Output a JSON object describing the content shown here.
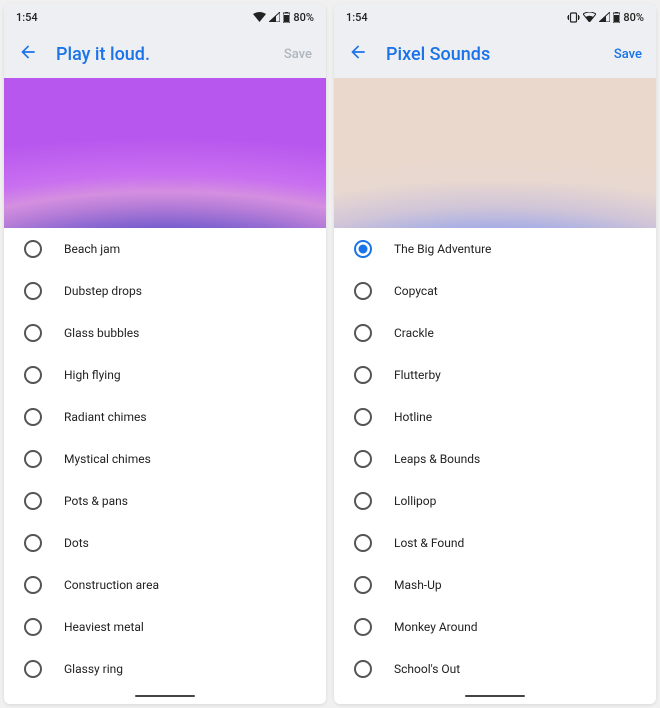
{
  "screens": [
    {
      "status": {
        "time": "1:54",
        "battery": "80%",
        "vibrate": false
      },
      "header": {
        "title": "Play it loud.",
        "save_label": "Save",
        "save_enabled": false
      },
      "hero_class": "hero-left",
      "items": [
        {
          "label": "Beach jam",
          "selected": false
        },
        {
          "label": "Dubstep drops",
          "selected": false
        },
        {
          "label": "Glass bubbles",
          "selected": false
        },
        {
          "label": "High flying",
          "selected": false
        },
        {
          "label": "Radiant chimes",
          "selected": false
        },
        {
          "label": "Mystical chimes",
          "selected": false
        },
        {
          "label": "Pots & pans",
          "selected": false
        },
        {
          "label": "Dots",
          "selected": false
        },
        {
          "label": "Construction area",
          "selected": false
        },
        {
          "label": "Heaviest metal",
          "selected": false
        },
        {
          "label": "Glassy ring",
          "selected": false
        }
      ]
    },
    {
      "status": {
        "time": "1:54",
        "battery": "80%",
        "vibrate": true
      },
      "header": {
        "title": "Pixel Sounds",
        "save_label": "Save",
        "save_enabled": true
      },
      "hero_class": "hero-right",
      "items": [
        {
          "label": "The Big Adventure",
          "selected": true
        },
        {
          "label": "Copycat",
          "selected": false
        },
        {
          "label": "Crackle",
          "selected": false
        },
        {
          "label": "Flutterby",
          "selected": false
        },
        {
          "label": "Hotline",
          "selected": false
        },
        {
          "label": "Leaps & Bounds",
          "selected": false
        },
        {
          "label": "Lollipop",
          "selected": false
        },
        {
          "label": "Lost & Found",
          "selected": false
        },
        {
          "label": "Mash-Up",
          "selected": false
        },
        {
          "label": "Monkey Around",
          "selected": false
        },
        {
          "label": "School's Out",
          "selected": false
        }
      ]
    }
  ]
}
